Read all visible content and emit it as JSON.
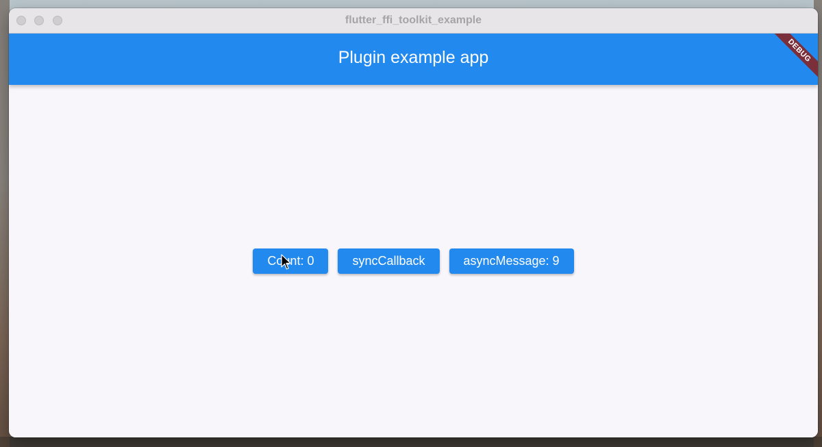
{
  "window": {
    "title": "flutter_ffi_toolkit_example"
  },
  "appbar": {
    "title": "Plugin example app",
    "debug_banner": "DEBUG"
  },
  "buttons": {
    "count_label": "Count: 0",
    "sync_label": "syncCallback",
    "async_label": "asyncMessage: 9"
  },
  "colors": {
    "primary": "#2289ee",
    "background": "#f8f6fa",
    "debug_ribbon": "#7b2f3a"
  },
  "icons": {
    "cursor": "mouse-pointer-icon"
  }
}
